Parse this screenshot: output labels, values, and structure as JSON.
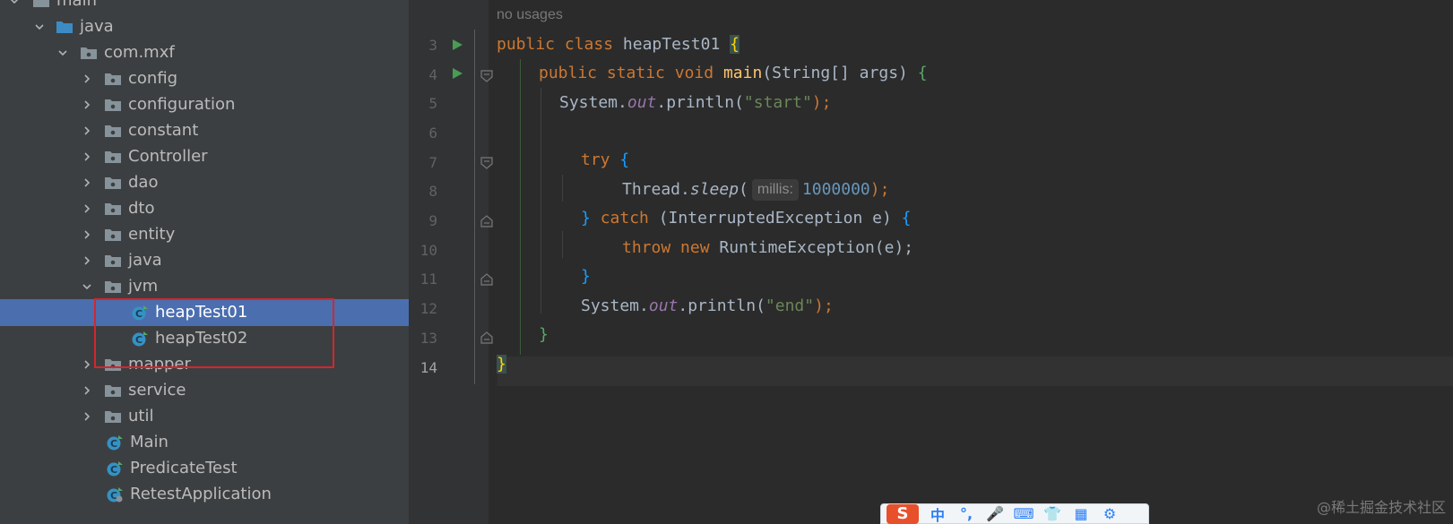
{
  "project_tree": {
    "items": [
      {
        "label": "main",
        "type": "folder",
        "expanded": true
      },
      {
        "label": "java",
        "type": "source-folder",
        "expanded": true
      },
      {
        "label": "com.mxf",
        "type": "package",
        "expanded": true
      },
      {
        "label": "config",
        "type": "package",
        "expanded": false
      },
      {
        "label": "configuration",
        "type": "package",
        "expanded": false
      },
      {
        "label": "constant",
        "type": "package",
        "expanded": false
      },
      {
        "label": "Controller",
        "type": "package",
        "expanded": false
      },
      {
        "label": "dao",
        "type": "package",
        "expanded": false
      },
      {
        "label": "dto",
        "type": "package",
        "expanded": false
      },
      {
        "label": "entity",
        "type": "package",
        "expanded": false
      },
      {
        "label": "java",
        "type": "package",
        "expanded": false
      },
      {
        "label": "jvm",
        "type": "package",
        "expanded": true
      },
      {
        "label": "heapTest01",
        "type": "class",
        "selected": true
      },
      {
        "label": "heapTest02",
        "type": "class"
      },
      {
        "label": "mapper",
        "type": "package",
        "expanded": false
      },
      {
        "label": "service",
        "type": "package",
        "expanded": false
      },
      {
        "label": "util",
        "type": "package",
        "expanded": false
      },
      {
        "label": "Main",
        "type": "class"
      },
      {
        "label": "PredicateTest",
        "type": "class"
      },
      {
        "label": "RetestApplication",
        "type": "spring-class"
      }
    ]
  },
  "editor": {
    "usage_hint": "no usages",
    "line_numbers": [
      "3",
      "4",
      "5",
      "6",
      "7",
      "8",
      "9",
      "10",
      "11",
      "12",
      "13",
      "14"
    ],
    "current_line": "14",
    "code": {
      "l3": {
        "kw1": "public",
        "kw2": "class",
        "name": "heapTest01",
        "brace": "{"
      },
      "l4": {
        "kw1": "public",
        "kw2": "static",
        "kw3": "void",
        "fn": "main",
        "params": "(String[] args)",
        "brace": "{"
      },
      "l5": {
        "pre": "System.",
        "field": "out",
        "mid": ".println(",
        "str": "\"start\"",
        "post": ");"
      },
      "l7": {
        "kw": "try",
        "brace": "{"
      },
      "l8": {
        "pre": "Thread.",
        "method": "sleep",
        "paren": "(",
        "hint": "millis:",
        "num": "1000000",
        "post": ");"
      },
      "l9": {
        "close": "}",
        "kw": "catch",
        "params": "(InterruptedException e)",
        "brace": "{"
      },
      "l10": {
        "kw1": "throw",
        "kw2": "new",
        "call": "RuntimeException(e);"
      },
      "l11": {
        "brace": "}"
      },
      "l12": {
        "pre": "System.",
        "field": "out",
        "mid": ".println(",
        "str": "\"end\"",
        "post": ");"
      },
      "l13": {
        "brace": "}"
      },
      "l14": {
        "brace": "}"
      }
    }
  },
  "ime_toolbar": {
    "logo": "S",
    "items": [
      "中",
      "°,",
      "🎤",
      "⌨",
      "👕",
      "▦",
      "⚙"
    ]
  },
  "watermark": "@稀土掘金技术社区",
  "colors": {
    "tree_bg": "#3c3f41",
    "selection": "#4b6eaf",
    "editor_bg": "#2b2b2b",
    "keyword": "#cc7832",
    "string": "#6a8759",
    "number": "#6897bb",
    "highlight_box": "#d4262d"
  }
}
